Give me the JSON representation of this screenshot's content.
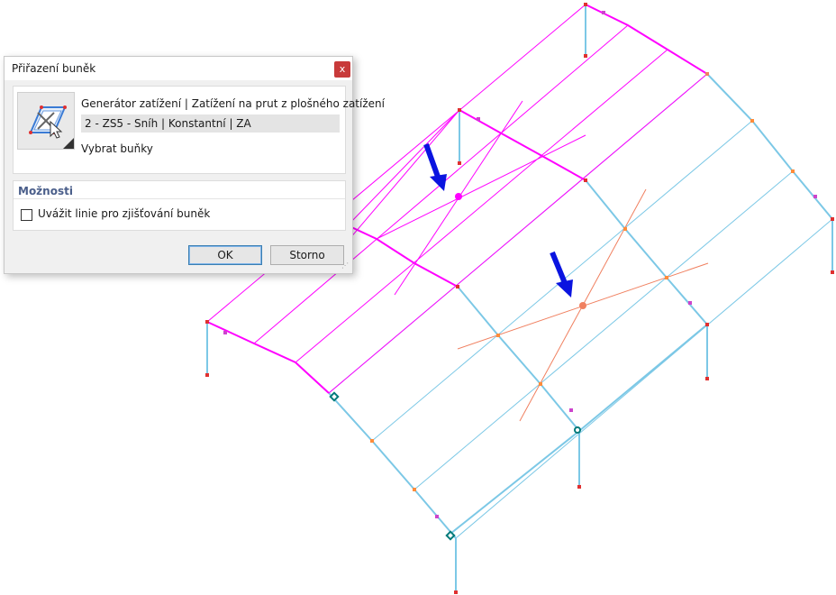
{
  "dialog": {
    "title": "Přiřazení buněk",
    "close_label": "x",
    "generator": "Generátor zatížení | Zatížení na prut z plošného zatížení",
    "load_case": "2 - ZS5 - Sníh | Konstantní | ZA",
    "select_cells": "Vybrat buňky",
    "options_header": "Možnosti",
    "option_lines": "Uvážit linie pro zjišťování buněk",
    "option_lines_checked": false,
    "ok_label": "OK",
    "cancel_label": "Storno"
  },
  "colors": {
    "loaded_members": "#ff00ff",
    "structure": "#7cc8e6",
    "cell_lines": "#f08060",
    "arrows": "#0a14e0",
    "supports": "#e03030",
    "nodes": "#ff8c3a",
    "hinges": "#007a7a"
  },
  "icons": [
    "close-icon",
    "cell-assignment-icon",
    "pointer-cursor-icon",
    "arrow-icon",
    "resize-grip-icon"
  ]
}
